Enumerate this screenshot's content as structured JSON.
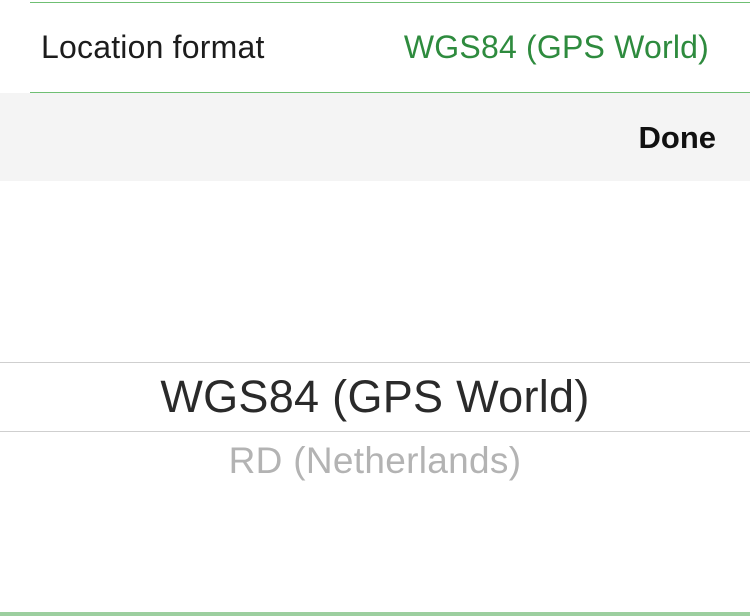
{
  "settings": {
    "location_format_label": "Location format",
    "location_format_value": "WGS84 (GPS World)"
  },
  "toolbar": {
    "done_label": "Done"
  },
  "picker": {
    "options": [
      {
        "label": "WGS84 (GPS World)",
        "selected": true
      },
      {
        "label": "RD (Netherlands)",
        "selected": false
      }
    ]
  },
  "colors": {
    "accent_green": "#2e8b3e",
    "separator_green": "#6fbf73",
    "toolbar_bg": "#f4f4f4"
  }
}
